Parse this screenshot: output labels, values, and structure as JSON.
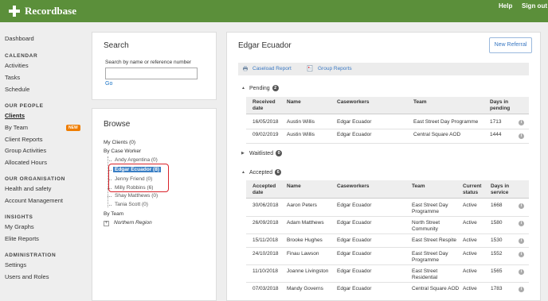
{
  "header": {
    "app_name": "Recordbase",
    "help": "Help",
    "sign_out": "Sign out",
    "brand_color": "#5b8f3a"
  },
  "nav": {
    "dashboard": "Dashboard",
    "calendar_heading": "CALENDAR",
    "activities": "Activities",
    "tasks": "Tasks",
    "schedule": "Schedule",
    "people_heading": "OUR PEOPLE",
    "clients": "Clients",
    "by_team": "By Team",
    "new_badge": "NEW",
    "client_reports": "Client Reports",
    "group_activities": "Group Activities",
    "allocated_hours": "Allocated Hours",
    "org_heading": "OUR ORGANISATION",
    "health_safety": "Health and safety",
    "account_mgmt": "Account Management",
    "insights_heading": "INSIGHTS",
    "my_graphs": "My Graphs",
    "elite_reports": "Elite Reports",
    "admin_heading": "ADMINISTRATION",
    "settings": "Settings",
    "users_roles": "Users and Roles"
  },
  "search": {
    "title": "Search",
    "label": "Search by name or reference number",
    "placeholder": "",
    "go": "Go"
  },
  "browse": {
    "title": "Browse",
    "my_clients": "My Clients (0)",
    "by_case_worker": "By Case Worker",
    "workers": [
      "Andy Argentina (0)",
      "Edgar Ecuador (8)",
      "Jenny Friend (0)",
      "Milly Robbins (6)",
      "Shay Matthews (0)",
      "Tania Scott (0)"
    ],
    "by_team": "By Team",
    "team_region": "Northern Region",
    "expander": "+"
  },
  "client": {
    "name": "Edgar Ecuador",
    "new_referral": "New Referral",
    "caseload_report": "Caseload Report",
    "group_reports": "Group Reports"
  },
  "pending": {
    "label": "Pending",
    "count": "2",
    "headers": [
      "Received date",
      "Name",
      "Caseworkers",
      "Team",
      "Days in pending"
    ],
    "rows": [
      [
        "16/05/2018",
        "Austin Willis",
        "Edgar Ecuador",
        "East Street Day Programme",
        "1713"
      ],
      [
        "09/02/2019",
        "Austin Willis",
        "Edgar Ecuador",
        "Central Square AOD",
        "1444"
      ]
    ]
  },
  "waitlisted": {
    "label": "Waitlisted",
    "count": "0"
  },
  "accepted": {
    "label": "Accepted",
    "count": "6",
    "headers": [
      "Accepted date",
      "Name",
      "Caseworkers",
      "Team",
      "Current status",
      "Days in service"
    ],
    "rows": [
      [
        "30/06/2018",
        "Aaron Peters",
        "Edgar Ecuador",
        "East Street Day Programme",
        "Active",
        "1668"
      ],
      [
        "26/09/2018",
        "Adam Matthews",
        "Edgar Ecuador",
        "North Street Community",
        "Active",
        "1580"
      ],
      [
        "15/11/2018",
        "Brooke Hughes",
        "Edgar Ecuador",
        "East Street Respite",
        "Active",
        "1530"
      ],
      [
        "24/10/2018",
        "Finau Lawson",
        "Edgar Ecuador",
        "East Street Day Programme",
        "Active",
        "1552"
      ],
      [
        "11/10/2018",
        "Joanne Livingston",
        "Edgar Ecuador",
        "East Street Residential",
        "Active",
        "1565"
      ],
      [
        "07/03/2018",
        "Mandy Governs",
        "Edgar Ecuador",
        "Central Square AOD",
        "Active",
        "1783"
      ]
    ]
  },
  "info_icon": "i",
  "colors": {
    "link": "#3a78c2",
    "selected": "#3b7fc4",
    "highlight_box": "#d9232a",
    "badge": "#ef7d00"
  }
}
